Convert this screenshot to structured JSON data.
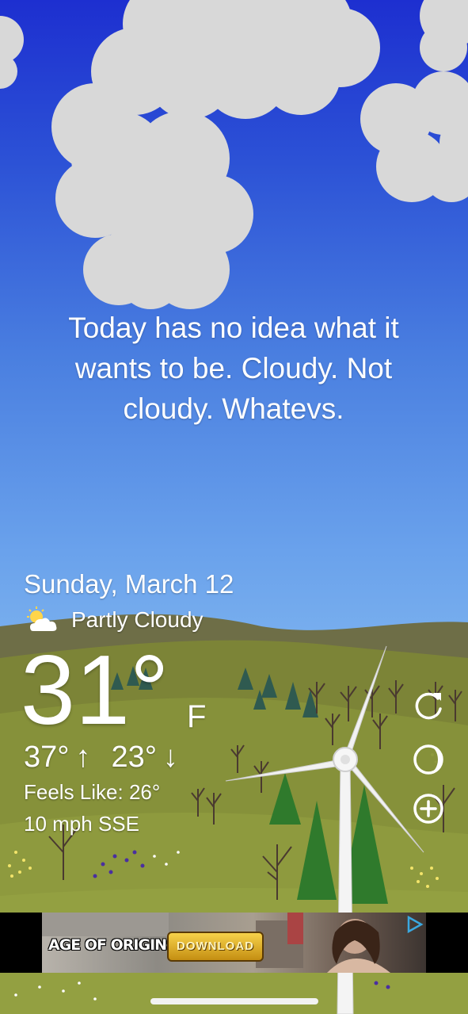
{
  "tagline": "Today has no idea what it wants to be. Cloudy. Not cloudy. Whatevs.",
  "date": "Sunday, March 12",
  "condition": {
    "icon": "partly-cloudy-icon",
    "label": "Partly Cloudy"
  },
  "temperature": {
    "value": "31°",
    "unit": "F"
  },
  "high": "37°",
  "high_arrow": "↑",
  "low": "23°",
  "low_arrow": "↓",
  "feels_like": "Feels Like: 26°",
  "wind": "10 mph SSE",
  "side_buttons": [
    "refresh-icon",
    "moon-phase-icon",
    "add-icon"
  ],
  "ad": {
    "title": "AGE OF ORIGINS",
    "button": "DOWNLOAD",
    "badge_icon": "adchoices-icon"
  },
  "colors": {
    "sky_top": "#1d2fd0",
    "sky_bottom": "#7ab0ee",
    "hill_far": "#6e6e47",
    "hill_mid": "#7f8a36",
    "hill_near": "#8d9a3c",
    "cloud": "#d9d9d9"
  }
}
